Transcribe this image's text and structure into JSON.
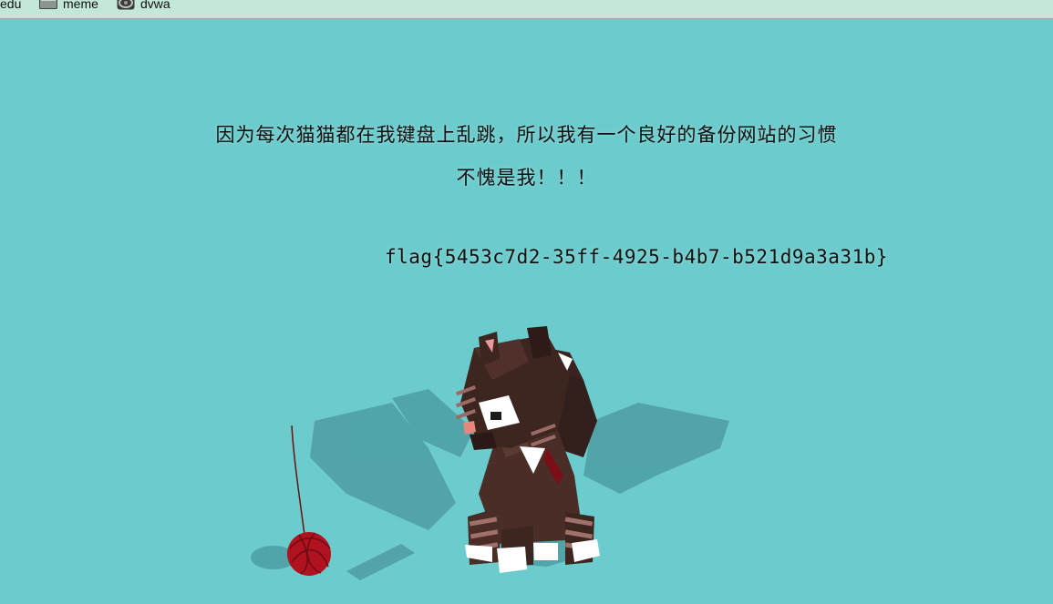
{
  "bookmarks": [
    {
      "label": "edu",
      "icon": "none"
    },
    {
      "label": "meme",
      "icon": "folder-icon"
    },
    {
      "label": "dvwa",
      "icon": "site-icon"
    }
  ],
  "page": {
    "line1": "因为每次猫猫都在我键盘上乱跳，所以我有一个良好的备份网站的习惯",
    "line2": "不愧是我！！！",
    "flag": "flag{5453c7d2-35ff-4925-b4b7-b521d9a3a31b}"
  },
  "colors": {
    "background": "#6ccbcc",
    "bookmarks_bar": "#c4e8d8",
    "cat_body": "#3d2520",
    "yarn": "#b0131f"
  }
}
